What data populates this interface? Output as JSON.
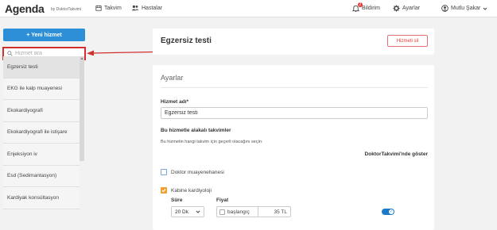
{
  "app": {
    "logo": "Agenda",
    "logo_sub": "by DoktorTakvimi"
  },
  "nav": {
    "calendar": "Takvim",
    "patients": "Hastalar",
    "notifications_label": "Bildirim",
    "notifications_count": "2",
    "settings": "Ayarlar",
    "user": "Mutlu Şakar"
  },
  "sidebar": {
    "new_service": "+ Yeni hizmet",
    "search_placeholder": "Hizmet ara",
    "items": [
      {
        "label": "Egzersiz testi"
      },
      {
        "label": "EKG ile kalp muayenesi"
      },
      {
        "label": "Ekokardiyografi"
      },
      {
        "label": "Ekokardiyografi ile istişare"
      },
      {
        "label": "Enjeksiyon iv"
      },
      {
        "label": "Esd (Sedimantasyon)"
      },
      {
        "label": "Kardiyak konsültasyon"
      }
    ]
  },
  "main": {
    "service_title": "Egzersiz testi",
    "delete_button": "Hizmeti sil",
    "section_title": "Ayarlar",
    "name_label": "Hizmet adı*",
    "name_value": "Egzersiz testi",
    "calendars_label": "Bu hizmetle alakalı takvimler",
    "calendars_help": "Bu hizmetin hangi takvim için geçerli olacağını seçin:",
    "show_on_dt": "DoktorTakvimi'nde göster",
    "calendars": [
      {
        "label": "Doktor muayenehanesi",
        "checked": false
      },
      {
        "label": "Kabine kardiyoloji",
        "checked": true
      }
    ],
    "duration_label": "Süre",
    "duration_value": "20 Dk",
    "price_label": "Fiyat",
    "price_start": "başlangıç",
    "price_value": "35 TL",
    "show_toggle": true
  },
  "colors": {
    "primary": "#2c8fd8",
    "danger": "#e53935",
    "checkbox_on": "#f0a030",
    "annotation": "#d32f2f"
  }
}
